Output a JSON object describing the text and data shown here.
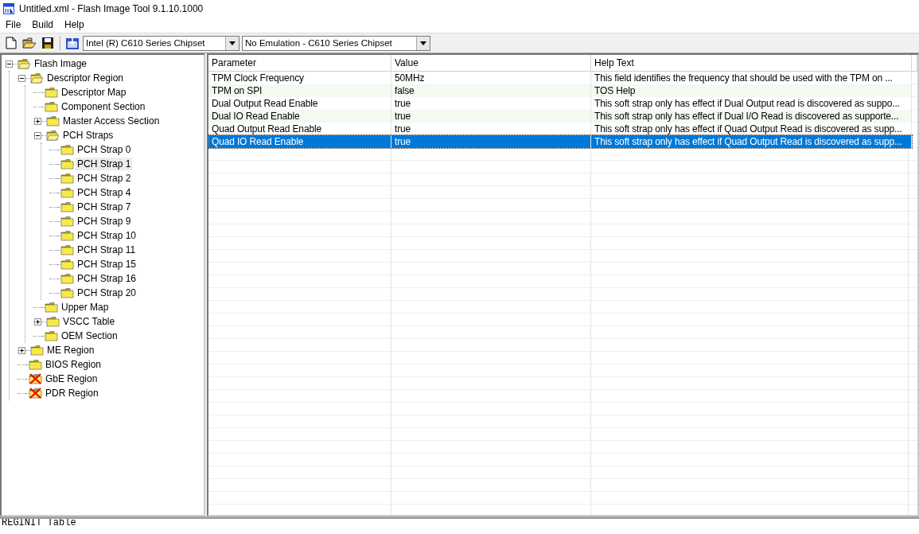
{
  "window": {
    "title": "Untitled.xml - Flash Image Tool 9.1.10.1000"
  },
  "menu": [
    "File",
    "Build",
    "Help"
  ],
  "toolbar": {
    "chipset": "Intel (R) C610 Series Chipset",
    "emulation": "No Emulation - C610 Series Chipset"
  },
  "tree": [
    {
      "label": "Flash Image",
      "kind": "open",
      "expanded": true,
      "selected": false,
      "children": [
        {
          "label": "Descriptor Region",
          "kind": "open",
          "expanded": true,
          "selected": false,
          "children": [
            {
              "label": "Descriptor Map",
              "kind": "folder",
              "selected": false
            },
            {
              "label": "Component Section",
              "kind": "folder",
              "selected": false
            },
            {
              "label": "Master Access Section",
              "kind": "folder",
              "expanded": false,
              "selected": false
            },
            {
              "label": "PCH Straps",
              "kind": "open",
              "expanded": true,
              "selected": false,
              "children": [
                {
                  "label": "PCH Strap 0",
                  "kind": "folder",
                  "selected": false
                },
                {
                  "label": "PCH Strap 1",
                  "kind": "folder",
                  "selected": true
                },
                {
                  "label": "PCH Strap 2",
                  "kind": "folder",
                  "selected": false
                },
                {
                  "label": "PCH Strap 4",
                  "kind": "folder",
                  "selected": false
                },
                {
                  "label": "PCH Strap 7",
                  "kind": "folder",
                  "selected": false
                },
                {
                  "label": "PCH Strap 9",
                  "kind": "folder",
                  "selected": false
                },
                {
                  "label": "PCH Strap 10",
                  "kind": "folder",
                  "selected": false
                },
                {
                  "label": "PCH Strap 11",
                  "kind": "folder",
                  "selected": false
                },
                {
                  "label": "PCH Strap 15",
                  "kind": "folder",
                  "selected": false
                },
                {
                  "label": "PCH Strap 16",
                  "kind": "folder",
                  "selected": false
                },
                {
                  "label": "PCH Strap 20",
                  "kind": "folder",
                  "selected": false
                }
              ]
            },
            {
              "label": "Upper Map",
              "kind": "folder",
              "selected": false
            },
            {
              "label": "VSCC Table",
              "kind": "folder",
              "expanded": false,
              "selected": false
            },
            {
              "label": "OEM Section",
              "kind": "folder",
              "selected": false
            }
          ]
        },
        {
          "label": "ME Region",
          "kind": "folder",
          "expanded": false,
          "selected": false
        },
        {
          "label": "BIOS Region",
          "kind": "folder",
          "selected": false
        },
        {
          "label": "GbE Region",
          "kind": "error",
          "selected": false
        },
        {
          "label": "PDR Region",
          "kind": "error",
          "selected": false
        }
      ]
    }
  ],
  "table": {
    "columns": [
      "Parameter",
      "Value",
      "Help Text"
    ],
    "rows": [
      {
        "parameter": "TPM Clock Frequency",
        "value": "50MHz",
        "help": "This field identifies the frequency that should be used with the TPM on ...",
        "selected": false
      },
      {
        "parameter": "TPM on SPI",
        "value": "false",
        "help": "TOS Help",
        "selected": false
      },
      {
        "parameter": "Dual Output Read Enable",
        "value": "true",
        "help": "This soft strap only has effect if Dual Output read is discovered as suppo...",
        "selected": false
      },
      {
        "parameter": "Dual IO Read Enable",
        "value": "true",
        "help": "This soft strap only has effect if Dual I/O Read is discovered as supporte...",
        "selected": false
      },
      {
        "parameter": "Quad Output Read Enable",
        "value": "true",
        "help": "This soft strap only has effect if Quad Output Read is discovered as supp...",
        "selected": false
      },
      {
        "parameter": "Quad IO Read Enable",
        "value": "true",
        "help": "This soft strap only has effect if Quad Output Read is discovered as supp...",
        "selected": true
      }
    ]
  },
  "log": [
    "REGINIT Table"
  ]
}
